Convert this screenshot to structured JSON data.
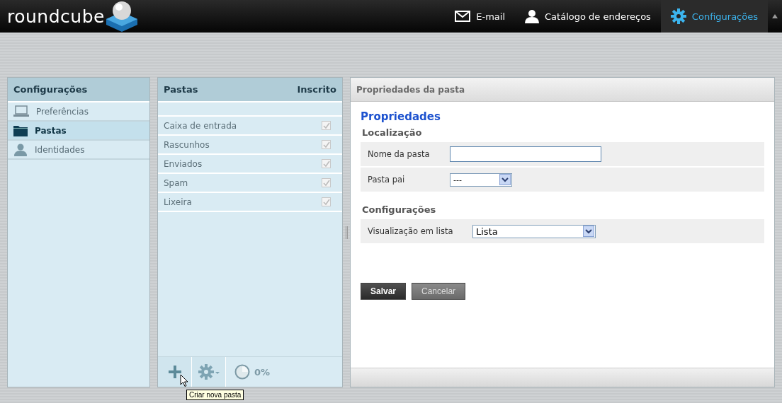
{
  "logo": {
    "text": "roundcube"
  },
  "topnav": [
    {
      "label": "E-mail",
      "kind": "mail",
      "selected": false
    },
    {
      "label": "Catálogo de endereços",
      "kind": "contacts",
      "selected": false
    },
    {
      "label": "Configurações",
      "kind": "settings",
      "selected": true
    }
  ],
  "sidebar": {
    "title": "Configurações",
    "items": [
      {
        "label": "Preferências",
        "kind": "preferences",
        "selected": false
      },
      {
        "label": "Pastas",
        "kind": "folders",
        "selected": true
      },
      {
        "label": "Identidades",
        "kind": "identities",
        "selected": false
      }
    ]
  },
  "folders": {
    "title": "Pastas",
    "column": "Inscrito",
    "rows": [
      {
        "name": "Caixa de entrada",
        "subscribed": true
      },
      {
        "name": "Rascunhos",
        "subscribed": true
      },
      {
        "name": "Enviados",
        "subscribed": true
      },
      {
        "name": "Spam",
        "subscribed": true
      },
      {
        "name": "Lixeira",
        "subscribed": true
      }
    ],
    "quota": "0%",
    "tooltip": "Criar nova pasta"
  },
  "properties": {
    "title": "Propriedades da pasta",
    "heading": "Propriedades",
    "sections": [
      {
        "legend": "Localização",
        "fields": [
          {
            "label": "Nome da pasta",
            "kind": "text"
          },
          {
            "label": "Pasta pai",
            "kind": "select",
            "value": "---"
          }
        ]
      },
      {
        "legend": "Configurações",
        "fields": [
          {
            "label": "Visualização em lista",
            "kind": "select",
            "value": "Lista"
          }
        ]
      }
    ],
    "buttons": [
      {
        "label": "Salvar",
        "kind": "primary"
      },
      {
        "label": "Cancelar",
        "kind": "secondary"
      }
    ]
  }
}
